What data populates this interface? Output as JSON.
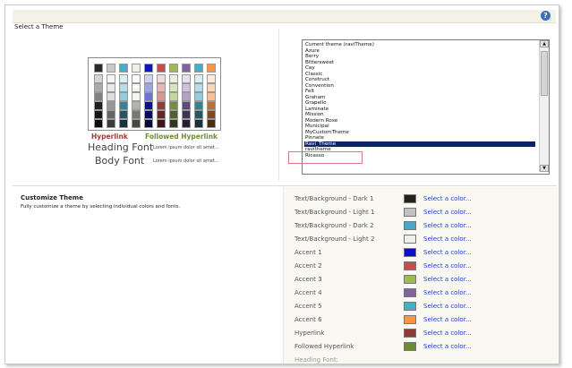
{
  "header": {
    "help_label": "?"
  },
  "select_theme": {
    "title": "Select a Theme",
    "preview": {
      "hyperlink": "Hyperlink",
      "followed_hyperlink": "Followed Hyperlink",
      "heading_font": "Heading Font",
      "body_font": "Body Font",
      "heading_sample": "Lorem ipsum dolor sit amet...",
      "body_sample": "Lorem ipsum dolor sit amet...",
      "colors": [
        "#2b2b25",
        "#c9c9c9",
        "#4aaac7",
        "#efefe7",
        "#0c18b8",
        "#c0504d",
        "#9bbb59",
        "#7f64a2",
        "#4bacc6",
        "#f79646"
      ]
    },
    "themes": [
      "Current theme (raviTheme)",
      "Azure",
      "Berry",
      "Bittersweet",
      "Cay",
      "Classic",
      "Construct",
      "Convention",
      "Felt",
      "Graham",
      "Grapello",
      "Laminate",
      "Mission",
      "Modern Rose",
      "Municipal",
      "MyCustomTheme",
      "Pinnate",
      "Ravi_Theme",
      "ravitheme",
      "Ricasso"
    ],
    "selected_theme": "Ravi_Theme"
  },
  "customize_theme": {
    "title": "Customize Theme",
    "description": "Fully customize a theme by selecting individual colors and fonts.",
    "link_label": "Select a color...",
    "rows": [
      {
        "label": "Text/Background - Dark 1",
        "color": "#222219"
      },
      {
        "label": "Text/Background - Light 1",
        "color": "#c2c2c2"
      },
      {
        "label": "Text/Background - Dark 2",
        "color": "#4aa7c8"
      },
      {
        "label": "Text/Background - Light 2",
        "color": "#efefe9"
      },
      {
        "label": "Accent 1",
        "color": "#0c10c6"
      },
      {
        "label": "Accent 2",
        "color": "#c0504d"
      },
      {
        "label": "Accent 3",
        "color": "#9bbb59"
      },
      {
        "label": "Accent 4",
        "color": "#7f64a2"
      },
      {
        "label": "Accent 5",
        "color": "#4bacc6"
      },
      {
        "label": "Accent 6",
        "color": "#f79646"
      },
      {
        "label": "Hyperlink",
        "color": "#8f3b35"
      },
      {
        "label": "Followed Hyperlink",
        "color": "#6c8a37"
      }
    ],
    "partial_row": "Heading Font:"
  }
}
